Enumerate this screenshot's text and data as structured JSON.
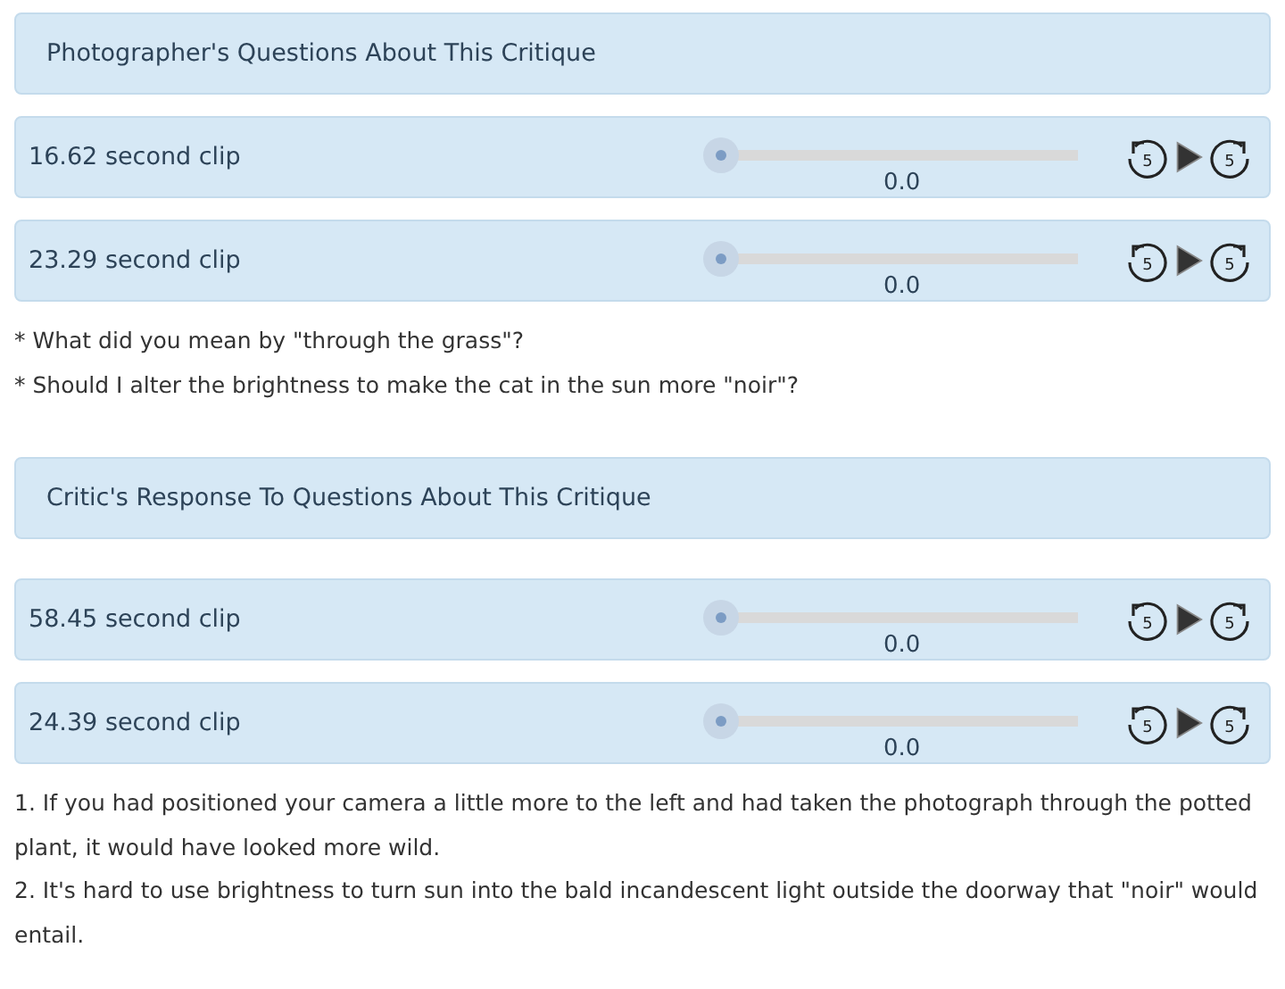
{
  "sections": [
    {
      "header": "Photographer's Questions About This Critique",
      "clips": [
        {
          "label": "16.62 second clip",
          "level": 0,
          "reading": "0.0",
          "back": "5",
          "forward": "5"
        },
        {
          "label": "23.29 second clip",
          "level": 0,
          "reading": "0.0",
          "back": "5",
          "forward": "5"
        }
      ],
      "notes": [
        "*  What did you mean by \"through the grass\"?",
        "*  Should I alter the brightness to make the cat in the sun more \"noir\"?"
      ]
    },
    {
      "header": "Critic's Response To Questions About This Critique",
      "clips": [
        {
          "label": "58.45 second clip",
          "level": 0,
          "reading": "0.0",
          "back": "5",
          "forward": "5"
        },
        {
          "label": "24.39 second clip",
          "level": 0,
          "reading": "0.0",
          "back": "5",
          "forward": "5"
        }
      ],
      "notes": [
        "1.  If you had positioned your camera a little more to the left and had taken the photograph through the potted plant, it would have looked more wild.",
        "2.  It's hard to use brightness to turn sun into the bald incandescent light outside the doorway that \"noir\" would entail."
      ]
    }
  ]
}
